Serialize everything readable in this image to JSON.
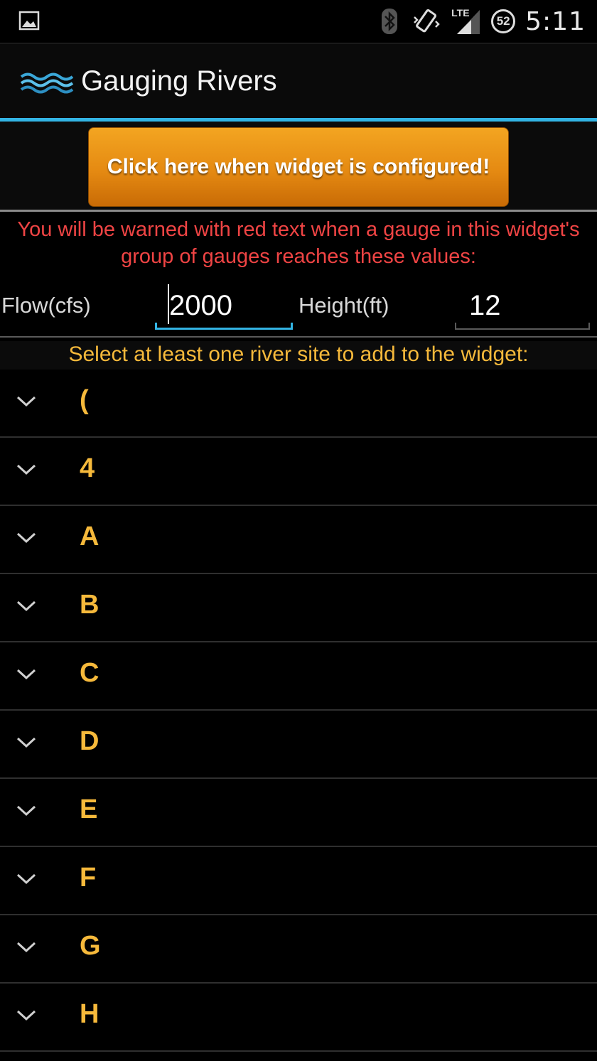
{
  "status_bar": {
    "time": "5:11",
    "network": "LTE",
    "battery": "52",
    "icons": [
      "gallery-icon",
      "bluetooth-icon",
      "vibrate-icon",
      "signal-icon",
      "battery-icon"
    ]
  },
  "app_bar": {
    "title": "Gauging Rivers",
    "icon": "waves-icon",
    "accent_color": "#33b5e5"
  },
  "configure_button": {
    "label": "Click here when widget is configured!"
  },
  "warning": {
    "text": "You will be warned with red text when a gauge in this widget's group of gauges reaches these values:",
    "color": "#ef4444"
  },
  "thresholds": {
    "flow_label": "Flow(cfs)",
    "flow_value": "2000",
    "height_label": "Height(ft)",
    "height_value": "12"
  },
  "select_hint": "Select at least one river site to add to the widget:",
  "groups": [
    {
      "label": "("
    },
    {
      "label": "4"
    },
    {
      "label": "A"
    },
    {
      "label": "B"
    },
    {
      "label": "C"
    },
    {
      "label": "D"
    },
    {
      "label": "E"
    },
    {
      "label": "F"
    },
    {
      "label": "G"
    },
    {
      "label": "H"
    }
  ]
}
